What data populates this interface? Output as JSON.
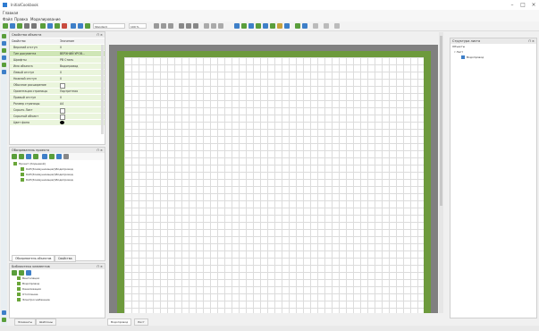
{
  "window": {
    "title": "InitialCookbook",
    "minimize": "–",
    "maximize": "□",
    "close": "×"
  },
  "menubar": {
    "items": [
      "Главная"
    ]
  },
  "mainmenu": {
    "items": [
      "Файл",
      "Правка",
      "Моделирование"
    ]
  },
  "toolbar": {
    "zoom_value": "100 %",
    "combo_value": "Standard"
  },
  "properties_panel": {
    "title": "Свойства объекта",
    "header_name": "Свойство",
    "header_value": "Значение",
    "rows": [
      {
        "name": "Верхний отступ",
        "value": "0"
      },
      {
        "name": "Тип документа",
        "value": "ВЕРХНИЙ УРОВ..."
      },
      {
        "name": "Шрифты",
        "value": "PB Стиль"
      },
      {
        "name": "Имя объекта",
        "value": "Водопровод"
      },
      {
        "name": "Левый отступ",
        "value": "0"
      },
      {
        "name": "Нижний отступ",
        "value": "0"
      },
      {
        "name": "Обычное расширение",
        "value": ""
      },
      {
        "name": "Ориентация страницы",
        "value": "Портретная"
      },
      {
        "name": "Правый отступ",
        "value": "0"
      },
      {
        "name": "Размер страницы",
        "value": "A4"
      },
      {
        "name": "Скрыть Лист",
        "value": ""
      },
      {
        "name": "Скрытый объект",
        "value": ""
      },
      {
        "name": "Цвет фона",
        "value": ""
      }
    ]
  },
  "project_panel": {
    "title": "Обозреватель проекта",
    "root": "Проект (Корневой)",
    "items": [
      "КАП(Коммуникации)\\Водопровод",
      "КАП(Коммуникации)\\Водопровод",
      "КАП(Коммуникации)\\Водопровод"
    ],
    "tabs": [
      "Обозреватель объектов",
      "Свойства"
    ]
  },
  "library_panel": {
    "title": "Библиотека элементов",
    "items": [
      "Вентиляция",
      "Водопровод",
      "Канализация",
      "Отопление",
      "Электроснабжение"
    ]
  },
  "right_panel": {
    "title": "Структура листа",
    "header": "Объекты",
    "root": "Лист",
    "child": "Водопровод"
  },
  "bottom_left_tabs": [
    "Элементы",
    "Шаблоны"
  ],
  "document_tabs": [
    "Водопровод",
    "Лист"
  ],
  "colors": {
    "accent_green": "#6d9a3c",
    "panel_green": "#eaf5dc"
  }
}
